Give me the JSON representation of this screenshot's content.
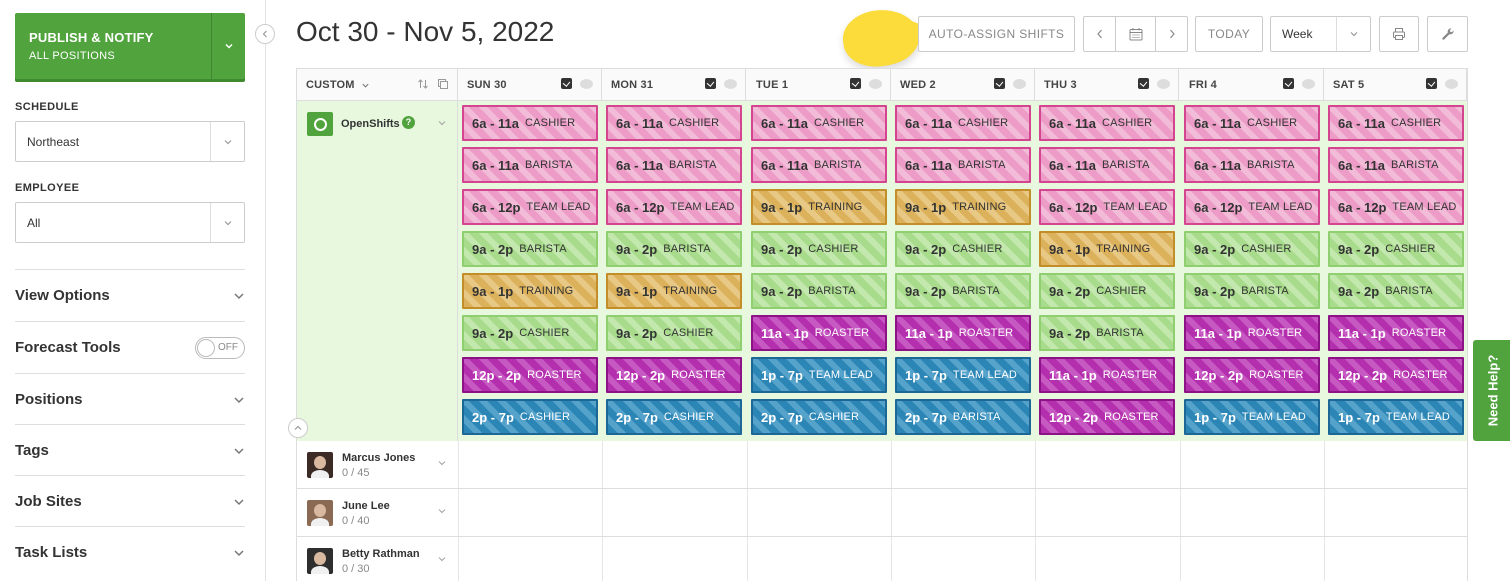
{
  "sidebar": {
    "publish": {
      "title": "PUBLISH & NOTIFY",
      "subtitle": "ALL POSITIONS"
    },
    "schedule_label": "SCHEDULE",
    "schedule_value": "Northeast",
    "employee_label": "EMPLOYEE",
    "employee_value": "All",
    "sections": [
      "View Options",
      "Forecast Tools",
      "Positions",
      "Tags",
      "Job Sites",
      "Task Lists"
    ],
    "forecast_toggle": "OFF"
  },
  "header": {
    "date_range": "Oct 30 - Nov 5, 2022",
    "auto_assign": "AUTO-ASSIGN SHIFTS",
    "today": "TODAY",
    "view": "Week"
  },
  "grid": {
    "first_col": "CUSTOM",
    "days": [
      "SUN 30",
      "MON 31",
      "TUE 1",
      "WED 2",
      "THU 3",
      "FRI 4",
      "SAT 5"
    ],
    "open_shifts_label": "OpenShifts",
    "colors": {
      "CASHIER": "#ec9cc6",
      "BARISTA": "#a8dc8c",
      "TRAINING": "#dcb15c",
      "ROASTER": "#b42fae",
      "TEAM LEAD": "#2b86b6"
    },
    "shift_rows": [
      [
        [
          "6a - 11a",
          "CASHIER",
          "pink"
        ],
        [
          "6a - 11a",
          "CASHIER",
          "pink"
        ],
        [
          "6a - 11a",
          "CASHIER",
          "pink"
        ],
        [
          "6a - 11a",
          "CASHIER",
          "pink"
        ],
        [
          "6a - 11a",
          "CASHIER",
          "pink"
        ],
        [
          "6a - 11a",
          "CASHIER",
          "pink"
        ],
        [
          "6a - 11a",
          "CASHIER",
          "pink"
        ]
      ],
      [
        [
          "6a - 11a",
          "BARISTA",
          "pink"
        ],
        [
          "6a - 11a",
          "BARISTA",
          "pink"
        ],
        [
          "6a - 11a",
          "BARISTA",
          "pink"
        ],
        [
          "6a - 11a",
          "BARISTA",
          "pink"
        ],
        [
          "6a - 11a",
          "BARISTA",
          "pink"
        ],
        [
          "6a - 11a",
          "BARISTA",
          "pink"
        ],
        [
          "6a - 11a",
          "BARISTA",
          "pink"
        ]
      ],
      [
        [
          "6a - 12p",
          "TEAM LEAD",
          "pink"
        ],
        [
          "6a - 12p",
          "TEAM LEAD",
          "pink"
        ],
        [
          "9a - 1p",
          "TRAINING",
          "gold"
        ],
        [
          "9a - 1p",
          "TRAINING",
          "gold"
        ],
        [
          "6a - 12p",
          "TEAM LEAD",
          "pink"
        ],
        [
          "6a - 12p",
          "TEAM LEAD",
          "pink"
        ],
        [
          "6a - 12p",
          "TEAM LEAD",
          "pink"
        ]
      ],
      [
        [
          "9a - 2p",
          "BARISTA",
          "green"
        ],
        [
          "9a - 2p",
          "BARISTA",
          "green"
        ],
        [
          "9a - 2p",
          "CASHIER",
          "green"
        ],
        [
          "9a - 2p",
          "CASHIER",
          "green"
        ],
        [
          "9a - 1p",
          "TRAINING",
          "gold"
        ],
        [
          "9a - 2p",
          "CASHIER",
          "green"
        ],
        [
          "9a - 2p",
          "CASHIER",
          "green"
        ]
      ],
      [
        [
          "9a - 1p",
          "TRAINING",
          "gold"
        ],
        [
          "9a - 1p",
          "TRAINING",
          "gold"
        ],
        [
          "9a - 2p",
          "BARISTA",
          "green"
        ],
        [
          "9a - 2p",
          "BARISTA",
          "green"
        ],
        [
          "9a - 2p",
          "CASHIER",
          "green"
        ],
        [
          "9a - 2p",
          "BARISTA",
          "green"
        ],
        [
          "9a - 2p",
          "BARISTA",
          "green"
        ]
      ],
      [
        [
          "9a - 2p",
          "CASHIER",
          "green"
        ],
        [
          "9a - 2p",
          "CASHIER",
          "green"
        ],
        [
          "11a - 1p",
          "ROASTER",
          "purple"
        ],
        [
          "11a - 1p",
          "ROASTER",
          "purple"
        ],
        [
          "9a - 2p",
          "BARISTA",
          "green"
        ],
        [
          "11a - 1p",
          "ROASTER",
          "purple"
        ],
        [
          "11a - 1p",
          "ROASTER",
          "purple"
        ]
      ],
      [
        [
          "12p - 2p",
          "ROASTER",
          "purple"
        ],
        [
          "12p - 2p",
          "ROASTER",
          "purple"
        ],
        [
          "1p - 7p",
          "TEAM LEAD",
          "blue"
        ],
        [
          "1p - 7p",
          "TEAM LEAD",
          "blue"
        ],
        [
          "11a - 1p",
          "ROASTER",
          "purple"
        ],
        [
          "12p - 2p",
          "ROASTER",
          "purple"
        ],
        [
          "12p - 2p",
          "ROASTER",
          "purple"
        ]
      ],
      [
        [
          "2p - 7p",
          "CASHIER",
          "blue"
        ],
        [
          "2p - 7p",
          "CASHIER",
          "blue"
        ],
        [
          "2p - 7p",
          "CASHIER",
          "blue"
        ],
        [
          "2p - 7p",
          "BARISTA",
          "blue"
        ],
        [
          "12p - 2p",
          "ROASTER",
          "purple"
        ],
        [
          "1p - 7p",
          "TEAM LEAD",
          "blue"
        ],
        [
          "1p - 7p",
          "TEAM LEAD",
          "blue"
        ]
      ]
    ],
    "employees": [
      {
        "name": "Marcus Jones",
        "hours": "0 / 45"
      },
      {
        "name": "June Lee",
        "hours": "0 / 40"
      },
      {
        "name": "Betty Rathman",
        "hours": "0 / 30"
      }
    ]
  },
  "help": "Need Help?"
}
